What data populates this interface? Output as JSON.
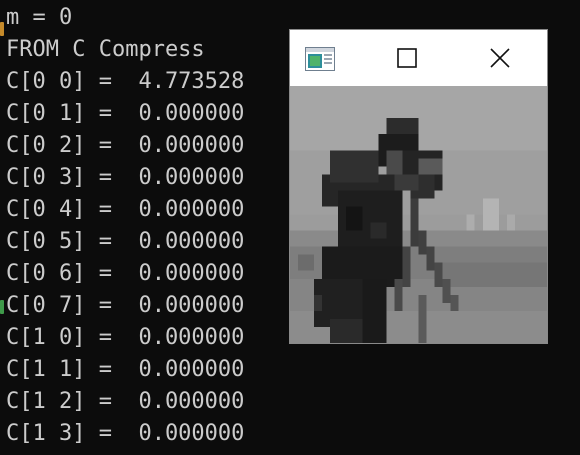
{
  "console": {
    "lines": [
      "m = 0",
      "FROM C Compress",
      "C[0 0] =  4.773528",
      "C[0 1] =  0.000000",
      "C[0 2] =  0.000000",
      "C[0 3] =  0.000000",
      "C[0 4] =  0.000000",
      "C[0 5] =  0.000000",
      "C[0 6] =  0.000000",
      "C[0 7] =  0.000000",
      "C[1 0] =  0.000000",
      "C[1 1] =  0.000000",
      "C[1 2] =  0.000000",
      "C[1 3] =  0.000000"
    ],
    "text_color": "#cccccc",
    "background": "#0c0c0c"
  },
  "image_window": {
    "icons": {
      "app": "app-window-icon",
      "maximize": "maximize-icon",
      "close": "close-icon"
    },
    "content": "pixelated grayscale photo of a cameraman with a tripod camera"
  }
}
